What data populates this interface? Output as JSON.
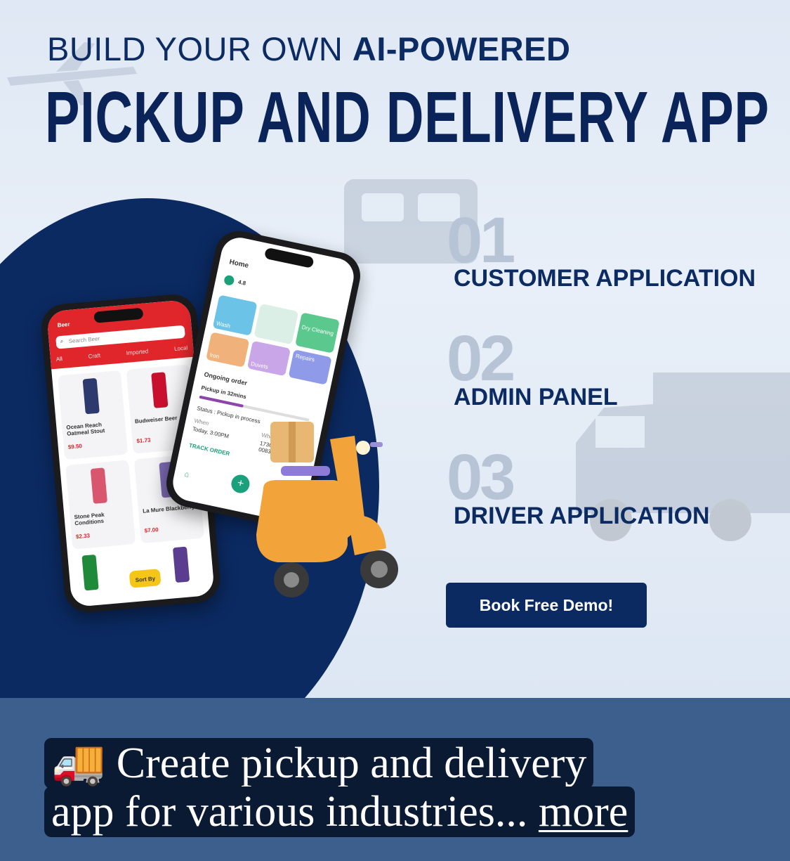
{
  "header": {
    "line1_prefix": "BUILD YOUR OWN ",
    "line1_bold": "AI-POWERED",
    "line2": "PICKUP AND DELIVERY APP"
  },
  "features": [
    {
      "number": "01",
      "label": "CUSTOMER APPLICATION"
    },
    {
      "number": "02",
      "label": "ADMIN PANEL"
    },
    {
      "number": "03",
      "label": "DRIVER APPLICATION"
    }
  ],
  "cta": {
    "label": "Book Free Demo!"
  },
  "phone_left": {
    "title": "Beer",
    "search_placeholder": "Search Beer",
    "tabs": [
      "All",
      "Craft",
      "Imported",
      "Local"
    ],
    "products": [
      {
        "name": "Ocean Reach Oatmeal Stout",
        "price": "$9.50"
      },
      {
        "name": "Budweiser Beer",
        "price": "$1.73"
      },
      {
        "name": "Stone Peak Conditions",
        "price": "$2.33"
      },
      {
        "name": "La Mure Blackberry",
        "price": "$7.00"
      }
    ],
    "sort_label": "Sort By"
  },
  "phone_right": {
    "title": "Home",
    "rating": "4.8",
    "services": [
      "Wash",
      "Dry Cleaning",
      "Iron",
      "Duvets",
      "Repairs"
    ],
    "ongoing_title": "Ongoing order",
    "pickup_text": "Pickup in 32mins",
    "status_text": "Status : Pickup in process",
    "when_label": "When",
    "when_value": "Today, 3:00PM",
    "where_label": "Where",
    "where_value": "1736 Pr Street, 0083",
    "track_label": "TRACK ORDER"
  },
  "caption": {
    "emoji": "🚚",
    "line1": "Create pickup and delivery",
    "line2": "app for various industries... ",
    "more": "more"
  },
  "colors": {
    "navy": "#0b2a62",
    "caption_bg": "#3c5f8d",
    "caption_box": "#0b1a33",
    "scooter": "#f2a43a",
    "red_header": "#e0262b"
  }
}
